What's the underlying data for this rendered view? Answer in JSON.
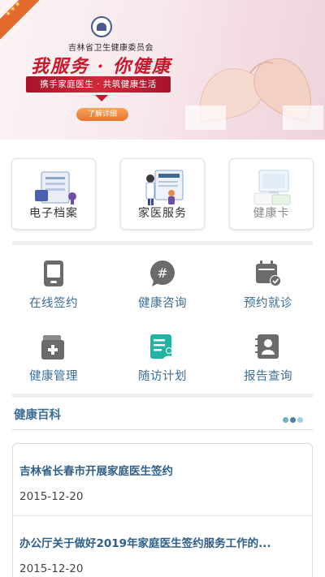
{
  "banner": {
    "org_name": "吉林省卫生健康委员会",
    "slogan": "我服务 · 你健康",
    "sub_slogan": "携手家庭医生 · 共筑健康生活",
    "more_button": "了解详细"
  },
  "tiles": [
    {
      "label": "电子档案",
      "icon": "e-file-icon"
    },
    {
      "label": "家医服务",
      "icon": "family-doctor-icon"
    },
    {
      "label": "健康卡",
      "icon": "health-card-icon"
    }
  ],
  "grid": [
    {
      "label": "在线签约",
      "icon": "phone-sign-icon"
    },
    {
      "label": "健康咨询",
      "icon": "chat-hash-icon"
    },
    {
      "label": "预约就诊",
      "icon": "calendar-check-icon"
    },
    {
      "label": "健康管理",
      "icon": "medical-box-icon"
    },
    {
      "label": "随访计划",
      "icon": "followup-plan-icon"
    },
    {
      "label": "报告查询",
      "icon": "report-user-icon"
    }
  ],
  "news": {
    "section_title": "健康百科",
    "items": [
      {
        "title": "吉林省长春市开展家庭医生签约",
        "date": "2015-12-20"
      },
      {
        "title": "办公厅关于做好2019年家庭医生签约服务工作的...",
        "date": "2015-12-20"
      }
    ]
  },
  "colors": {
    "accent_blue": "#3b6d96",
    "slogan_red": "#c8182c",
    "icon_gray": "#6b6b6b",
    "icon_teal": "#23b3a4",
    "dot_colors": [
      "#6bb3c9",
      "#4a7fb0",
      "#9fd0e0"
    ]
  }
}
